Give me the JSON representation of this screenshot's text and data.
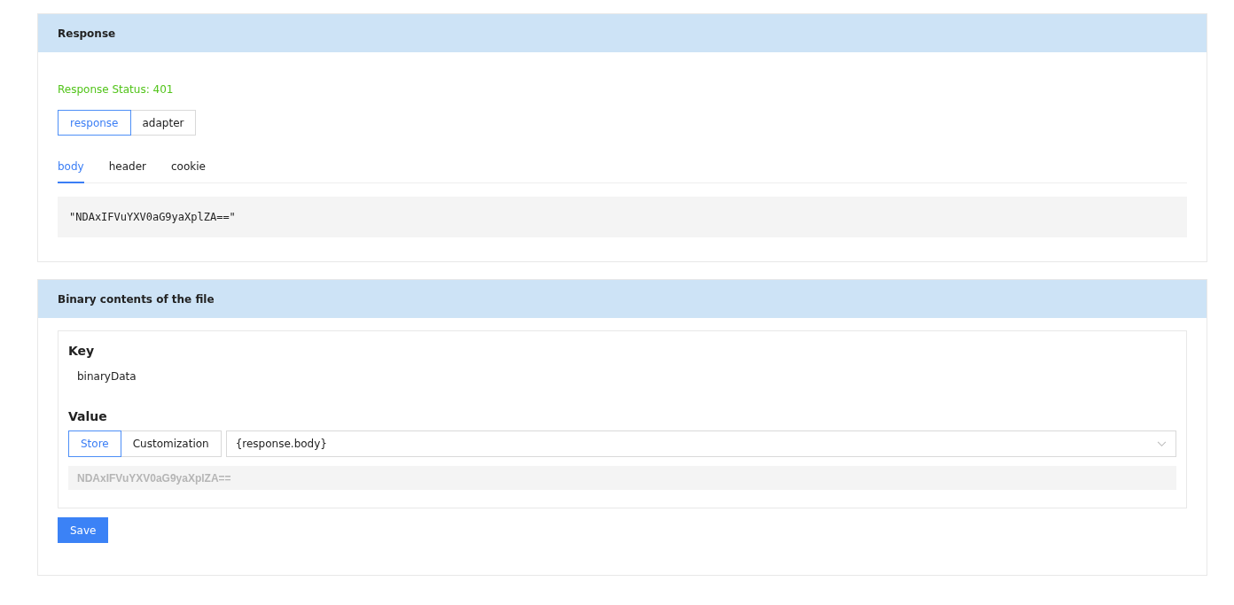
{
  "response_panel": {
    "title": "Response",
    "status": "Response Status: 401",
    "modes": [
      {
        "label": "response",
        "selected": true
      },
      {
        "label": "adapter",
        "selected": false
      }
    ],
    "tabs": [
      {
        "label": "body",
        "selected": true
      },
      {
        "label": "header",
        "selected": false
      },
      {
        "label": "cookie",
        "selected": false
      }
    ],
    "body": "\"NDAxIFVuYXV0aG9yaXplZA==\""
  },
  "file_panel": {
    "title": "Binary contents of the file",
    "key_label": "Key",
    "key_value": "binaryData",
    "value_label": "Value",
    "sources": [
      {
        "label": "Store",
        "selected": true
      },
      {
        "label": "Customization",
        "selected": false
      }
    ],
    "select_value": "{response.body}",
    "preview": "NDAxIFVuYXV0aG9yaXplZA==",
    "save": "Save"
  }
}
